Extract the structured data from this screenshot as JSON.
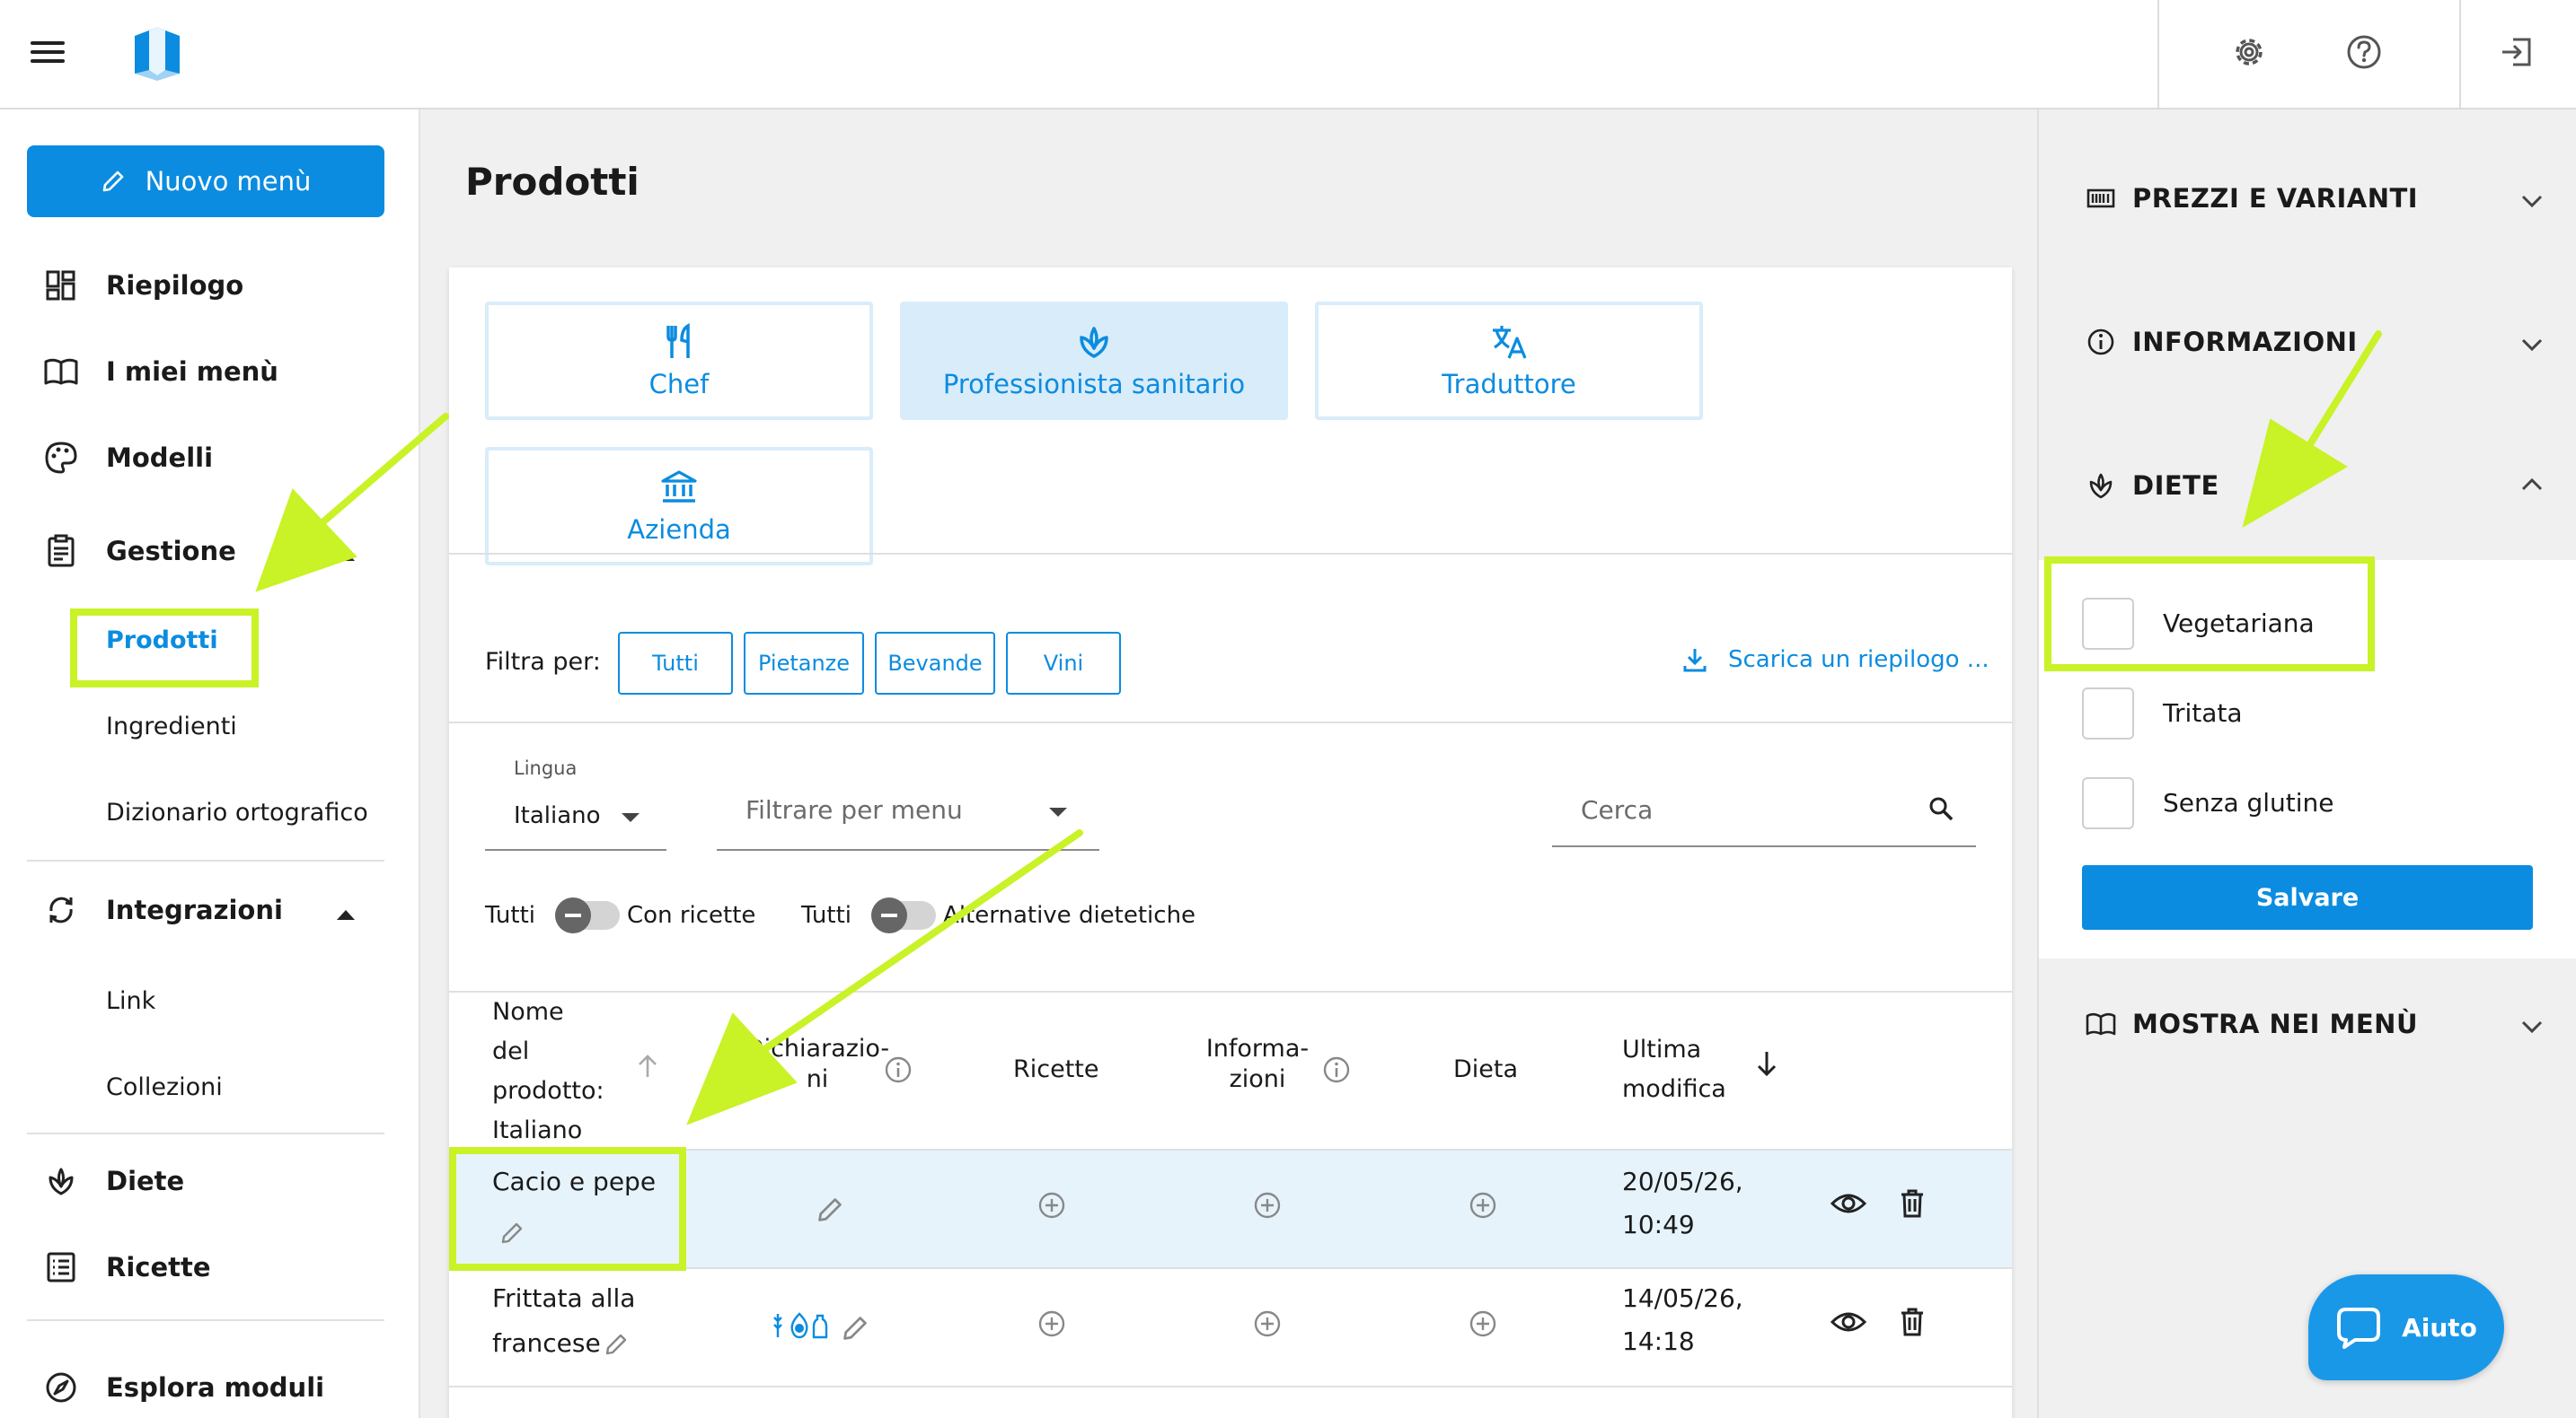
{
  "colors": {
    "accent": "#0b8ce0",
    "annotation": "#c9f227",
    "selected_bg": "#d9ecf9",
    "row_highlight": "#e6f3fb"
  },
  "header": {
    "icons": [
      "menu-icon",
      "app-logo",
      "settings-icon",
      "help-icon",
      "logout-icon"
    ]
  },
  "sidebar": {
    "new_menu": "Nuovo menù",
    "items": {
      "riepilogo": "Riepilogo",
      "miei_menu": "I miei menù",
      "modelli": "Modelli",
      "gestione": "Gestione",
      "prodotti": "Prodotti",
      "ingredienti": "Ingredienti",
      "dizionario": "Dizionario ortografico",
      "integrazioni": "Integrazioni",
      "link": "Link",
      "collezioni": "Collezioni",
      "diete": "Diete",
      "ricette": "Ricette",
      "esplora": "Esplora moduli"
    }
  },
  "main": {
    "title": "Prodotti",
    "roles": {
      "chef": "Chef",
      "sanitario": "Professionista sanitario",
      "traduttore": "Traduttore",
      "azienda": "Azienda"
    },
    "selected_role": "Professionista sanitario",
    "filter_label": "Filtra per:",
    "filters": {
      "tutti": "Tutti",
      "pietanze": "Pietanze",
      "bevande": "Bevande",
      "vini": "Vini"
    },
    "download": "Scarica un riepilogo ...",
    "language_label": "Lingua",
    "language_value": "Italiano",
    "menu_filter_placeholder": "Filtrare per menu",
    "search_placeholder": "Cerca",
    "toggle1": {
      "off": "Tutti",
      "on": "Con ricette"
    },
    "toggle2": {
      "off": "Tutti",
      "on": "Alternative dietetiche"
    },
    "columns": {
      "name_l1": "Nome",
      "name_l2": "del",
      "name_l3": "prodotto:",
      "name_l4": "Italiano",
      "decl_l1": "Dichiarazio-",
      "decl_l2": "ni",
      "ricette": "Ricette",
      "info_l1": "Informa-",
      "info_l2": "zioni",
      "dieta": "Dieta",
      "mod_l1": "Ultima",
      "mod_l2": "modifica"
    },
    "rows": [
      {
        "name": "Cacio e pepe",
        "date": "20/05/26,",
        "time": "10:49"
      },
      {
        "name_l1": "Frittata alla",
        "name_l2": "francese",
        "date": "14/05/26,",
        "time": "14:18"
      }
    ]
  },
  "right_panel": {
    "prezzi": "PREZZI E VARIANTI",
    "informazioni": "INFORMAZIONI",
    "diete": "DIETE",
    "diet_options": {
      "vegetariana": "Vegetariana",
      "tritata": "Tritata",
      "senza_glutine": "Senza glutine"
    },
    "save": "Salvare",
    "mostra": "MOSTRA NEI MENÙ"
  },
  "help": "Aiuto"
}
